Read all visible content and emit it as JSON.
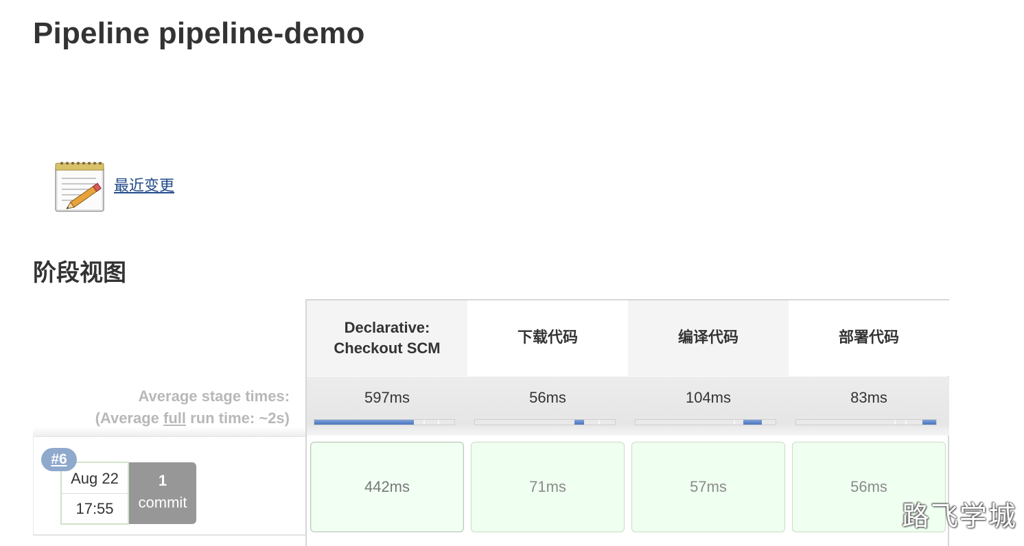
{
  "page": {
    "title": "Pipeline pipeline-demo"
  },
  "recent_changes": {
    "label": "最近变更",
    "icon": "notepad-pencil-icon"
  },
  "stage_view": {
    "title": "阶段视图",
    "average_label_line1": "Average stage times:",
    "average_label_line2_prefix": "(Average ",
    "average_label_line2_link": "full",
    "average_label_line2_suffix": " run time: ~2s)",
    "stages": [
      {
        "name": "Declarative: Checkout SCM",
        "average": "597ms",
        "avg_fraction": 0.71,
        "run_time": "442ms"
      },
      {
        "name": "下载代码",
        "average": "56ms",
        "avg_fraction": 0.07,
        "run_time": "71ms"
      },
      {
        "name": "编译代码",
        "average": "104ms",
        "avg_fraction": 0.13,
        "run_time": "57ms"
      },
      {
        "name": "部署代码",
        "average": "83ms",
        "avg_fraction": 0.1,
        "run_time": "56ms"
      }
    ],
    "run": {
      "number": "#6",
      "date": "Aug 22",
      "time": "17:55",
      "commit_count": "1",
      "commit_label": "commit",
      "status_color": "#effff0"
    }
  },
  "watermark": "路飞学城",
  "colors": {
    "progress": "#4c74c0",
    "badge": "#8fa9cc",
    "link": "#204a87",
    "success_cell": "#effff0"
  }
}
